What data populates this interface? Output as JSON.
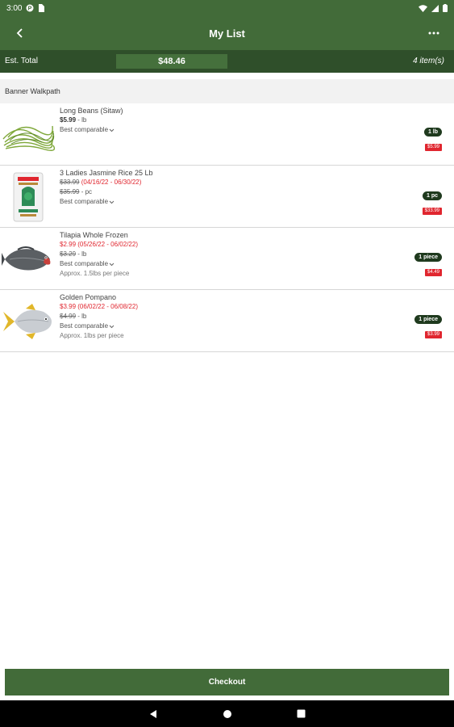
{
  "status_bar": {
    "time": "3:00"
  },
  "header": {
    "title": "My List"
  },
  "summary": {
    "est_label": "Est. Total",
    "est_total": "$48.46",
    "item_count": "4 item(s)"
  },
  "store": {
    "name": "Banner Walkpath"
  },
  "items": [
    {
      "name": "Long Beans (Sitaw)",
      "price": "$5.99",
      "unit": "- lb",
      "comparable": "Best comparable",
      "qty": "1 lb",
      "line_total": "$5.99"
    },
    {
      "name": "3 Ladies Jasmine Rice 25 Lb",
      "sale_price": "$33.99",
      "sale_dates": "(04/16/22 - 06/30/22)",
      "regular_price": "$35.99",
      "unit": "- pc",
      "comparable": "Best comparable",
      "qty": "1 pc",
      "line_total": "$33.99"
    },
    {
      "name": "Tilapia Whole Frozen",
      "sale_price": "$2.99",
      "sale_dates": "(05/26/22 - 06/02/22)",
      "regular_price": "$3.29",
      "unit": "- lb",
      "comparable": "Best comparable",
      "approx": "Approx. 1.5lbs per piece",
      "qty": "1 piece",
      "line_total": "$4.49"
    },
    {
      "name": "Golden Pompano",
      "sale_price": "$3.99",
      "sale_dates": "(06/02/22 - 06/08/22)",
      "regular_price": "$4.99",
      "unit": "- lb",
      "comparable": "Best comparable",
      "approx": "Approx. 1lbs per piece",
      "qty": "1 piece",
      "line_total": "$3.99"
    }
  ],
  "footer": {
    "checkout_label": "Checkout"
  },
  "colors": {
    "brand_green": "#426b39",
    "dark_green": "#2f4f2a",
    "sale_red": "#e0262f",
    "badge_dark": "#1f3a1e"
  }
}
